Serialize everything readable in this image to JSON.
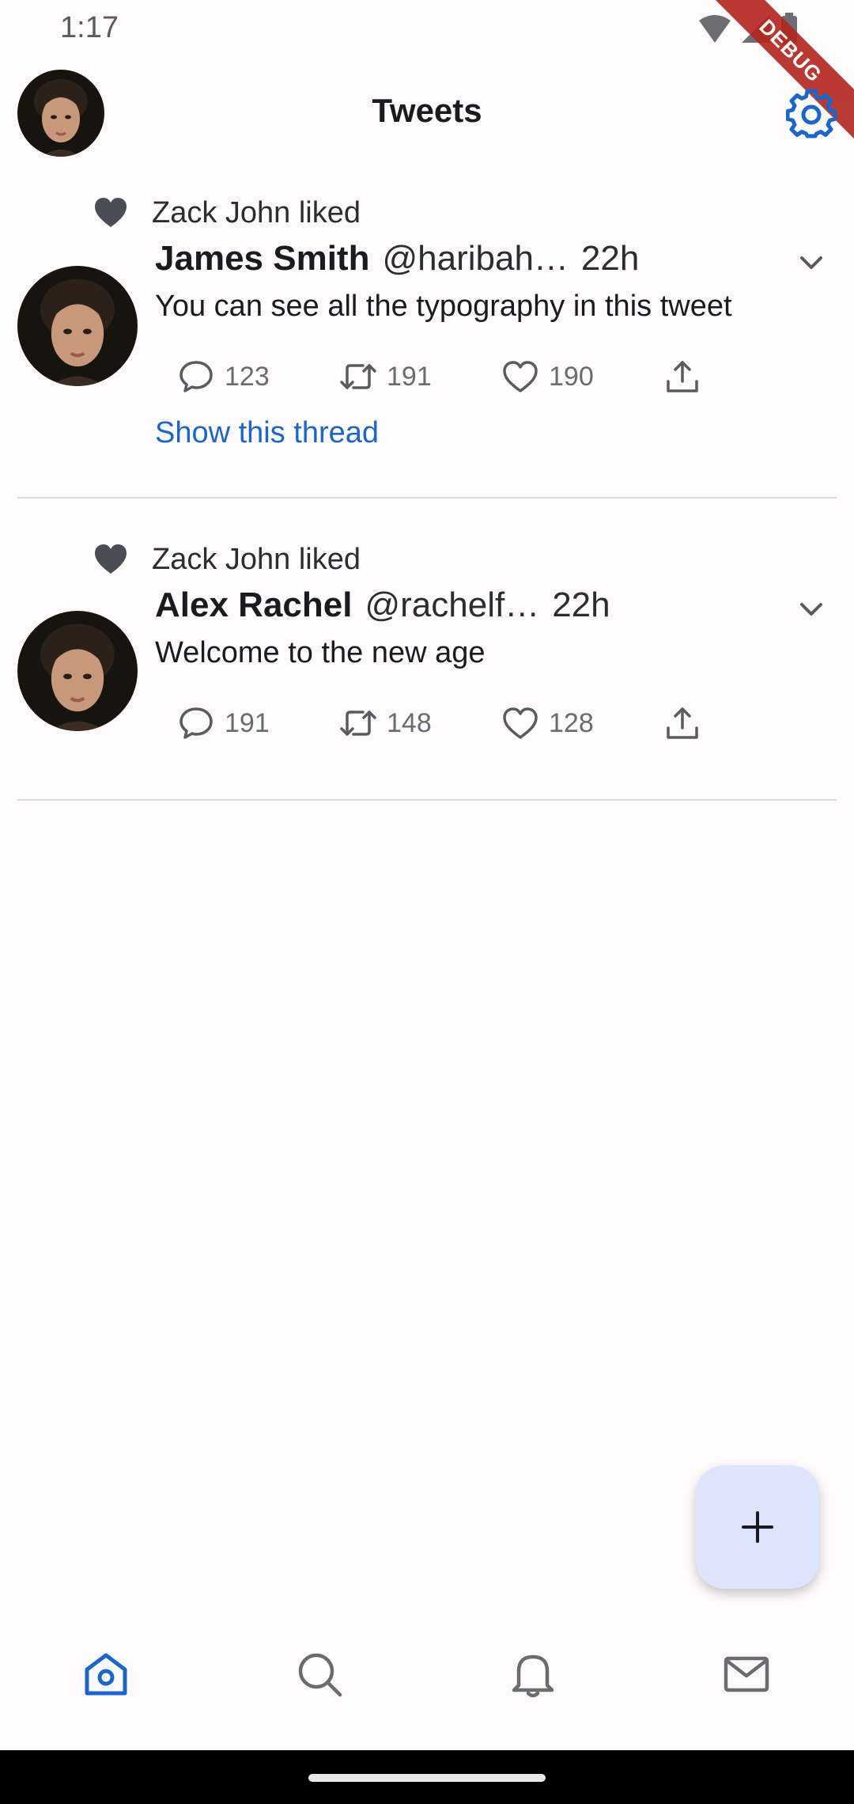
{
  "status_bar": {
    "time": "1:17"
  },
  "debug_banner": "DEBUG",
  "app_bar": {
    "title": "Tweets"
  },
  "tweets": [
    {
      "liked_by": "Zack John liked",
      "name": "James Smith",
      "handle": "@haribah…",
      "time": "22h",
      "body": "You can see all the typography in this tweet",
      "replies": "123",
      "retweets": "191",
      "likes": "190",
      "show_thread": "Show this thread"
    },
    {
      "liked_by": "Zack John liked",
      "name": "Alex Rachel",
      "handle": "@rachelf…",
      "time": "22h",
      "body": "Welcome to the new age",
      "replies": "191",
      "retweets": "148",
      "likes": "128"
    }
  ],
  "colors": {
    "accent": "#1d66c9",
    "fab_bg": "#dde4fb",
    "background": "#fefbfd"
  },
  "icons": {
    "settings": "gear-icon",
    "fab": "plus-icon",
    "nav": [
      "home-icon",
      "search-icon",
      "bell-icon",
      "mail-icon"
    ]
  }
}
